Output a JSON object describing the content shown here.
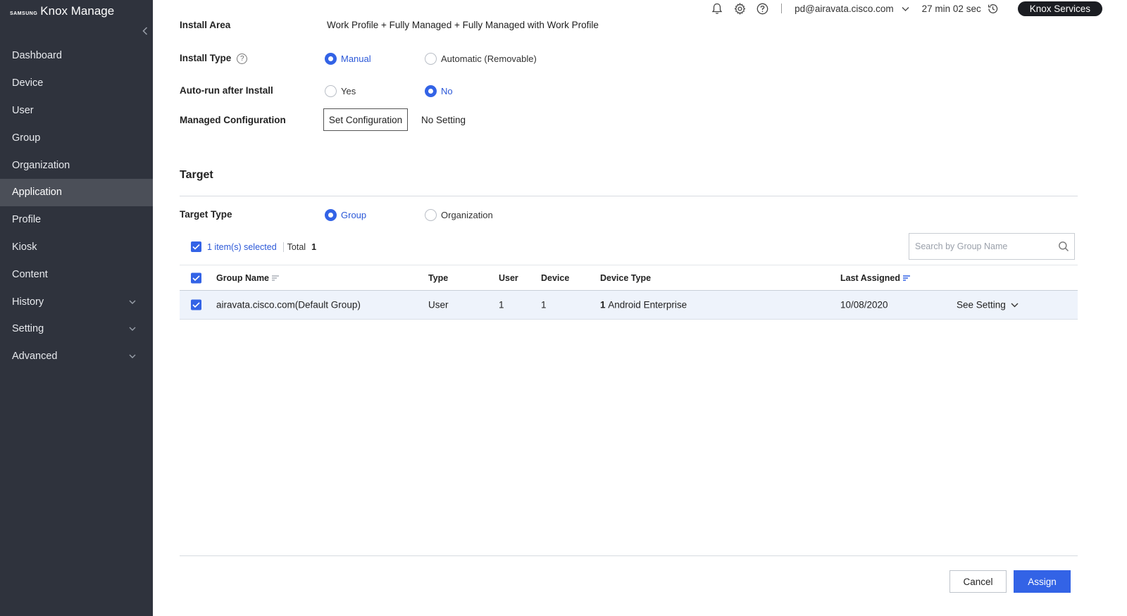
{
  "brand": {
    "maker": "SAMSUNG",
    "product": "Knox Manage"
  },
  "sidebar": {
    "items": [
      {
        "label": "Dashboard"
      },
      {
        "label": "Device"
      },
      {
        "label": "User"
      },
      {
        "label": "Group"
      },
      {
        "label": "Organization"
      },
      {
        "label": "Application",
        "active": true
      },
      {
        "label": "Profile"
      },
      {
        "label": "Kiosk"
      },
      {
        "label": "Content"
      },
      {
        "label": "History",
        "expandable": true
      },
      {
        "label": "Setting",
        "expandable": true
      },
      {
        "label": "Advanced",
        "expandable": true
      }
    ]
  },
  "topbar": {
    "user_email": "pd@airavata.cisco.com",
    "session_time": "27 min 02 sec",
    "knox_services": "Knox Services",
    "icons": [
      "bell-icon",
      "gear-icon",
      "help-icon",
      "history-icon"
    ]
  },
  "form": {
    "install_area": {
      "label": "Install Area",
      "value": "Work Profile + Fully Managed + Fully Managed with Work Profile"
    },
    "install_type": {
      "label": "Install Type",
      "options": [
        "Manual",
        "Automatic (Removable)"
      ],
      "selected": "Manual"
    },
    "auto_run": {
      "label": "Auto-run after Install",
      "options": [
        "Yes",
        "No"
      ],
      "selected": "No"
    },
    "managed_config": {
      "label": "Managed Configuration",
      "button": "Set Configuration",
      "value": "No Setting"
    }
  },
  "target": {
    "title": "Target",
    "type_label": "Target Type",
    "type_options": [
      "Group",
      "Organization"
    ],
    "type_selected": "Group",
    "selected_text": "1 item(s) selected",
    "total_label": "Total",
    "total_count": "1",
    "search_placeholder": "Search by Group Name",
    "columns": [
      "Group Name",
      "Type",
      "User",
      "Device",
      "Device Type",
      "Last Assigned"
    ],
    "rows": [
      {
        "group_name": "airavata.cisco.com(Default Group)",
        "type": "User",
        "user": "1",
        "device": "1",
        "device_type_count": "1",
        "device_type": "Android Enterprise",
        "last_assigned": "10/08/2020",
        "action": "See Setting"
      }
    ]
  },
  "footer": {
    "cancel": "Cancel",
    "assign": "Assign"
  },
  "colors": {
    "accent": "#3363e6",
    "sidebar_bg": "#2f333d",
    "sidebar_active": "#4b4f58",
    "row_selected": "#eef3fb"
  }
}
